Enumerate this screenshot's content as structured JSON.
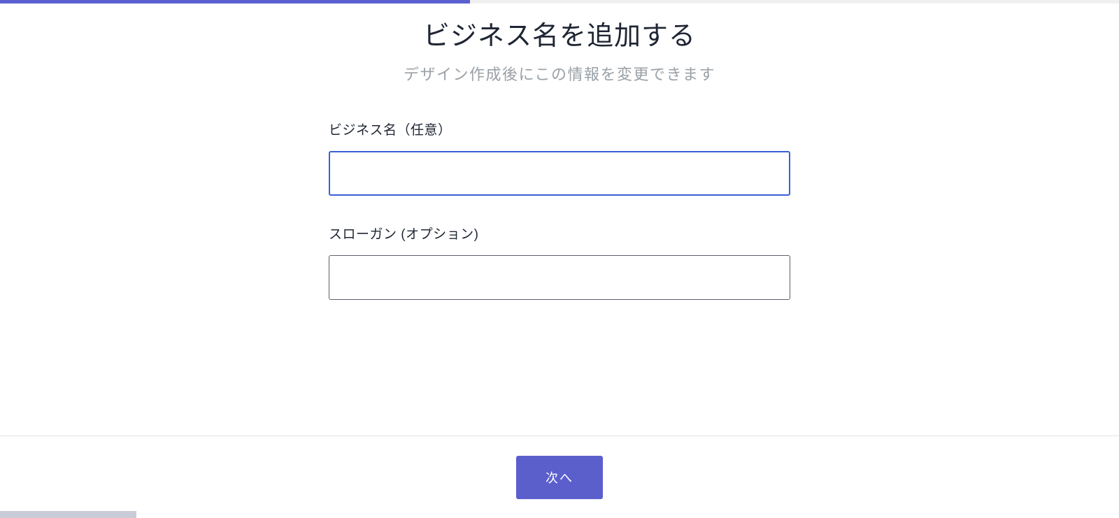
{
  "header": {
    "title": "ビジネス名を追加する",
    "subtitle": "デザイン作成後にこの情報を変更できます"
  },
  "form": {
    "business_name": {
      "label": "ビジネス名（任意）",
      "value": ""
    },
    "slogan": {
      "label": "スローガン (オプション)",
      "value": ""
    }
  },
  "footer": {
    "next_label": "次へ"
  },
  "progress": {
    "percent": 42
  }
}
